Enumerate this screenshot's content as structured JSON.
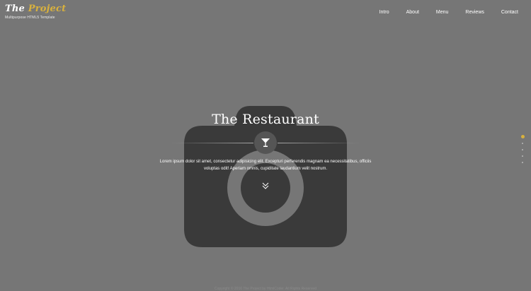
{
  "logo": {
    "title_part1": "The",
    "title_part2": "Project",
    "tagline": "Multipurpose HTML5 Template"
  },
  "nav": {
    "items": [
      {
        "label": "Intro"
      },
      {
        "label": "About"
      },
      {
        "label": "Menu"
      },
      {
        "label": "Reviews"
      },
      {
        "label": "Contact"
      }
    ]
  },
  "hero": {
    "title": "The Restaurant",
    "icon": "cocktail-glass-icon",
    "text": "Lorem ipsum dolor sit amet, consectetur adipisicing elit. Excepturi perferendis magnam ea necessitatibus, officiis voluptas odit! Aperiam omnis, cupiditate laudantium velit nostrum.",
    "scroll_icon": "double-chevron-down-icon"
  },
  "side_nav": {
    "dot_count": 5,
    "active_index": 0
  },
  "footer": {
    "text": "Copyright © 2016 The Project by HtmlCoder. All Rights Reserved"
  },
  "colors": {
    "background": "#767676",
    "accent": "#d8b13e",
    "placeholder": "#3a3a3a"
  }
}
